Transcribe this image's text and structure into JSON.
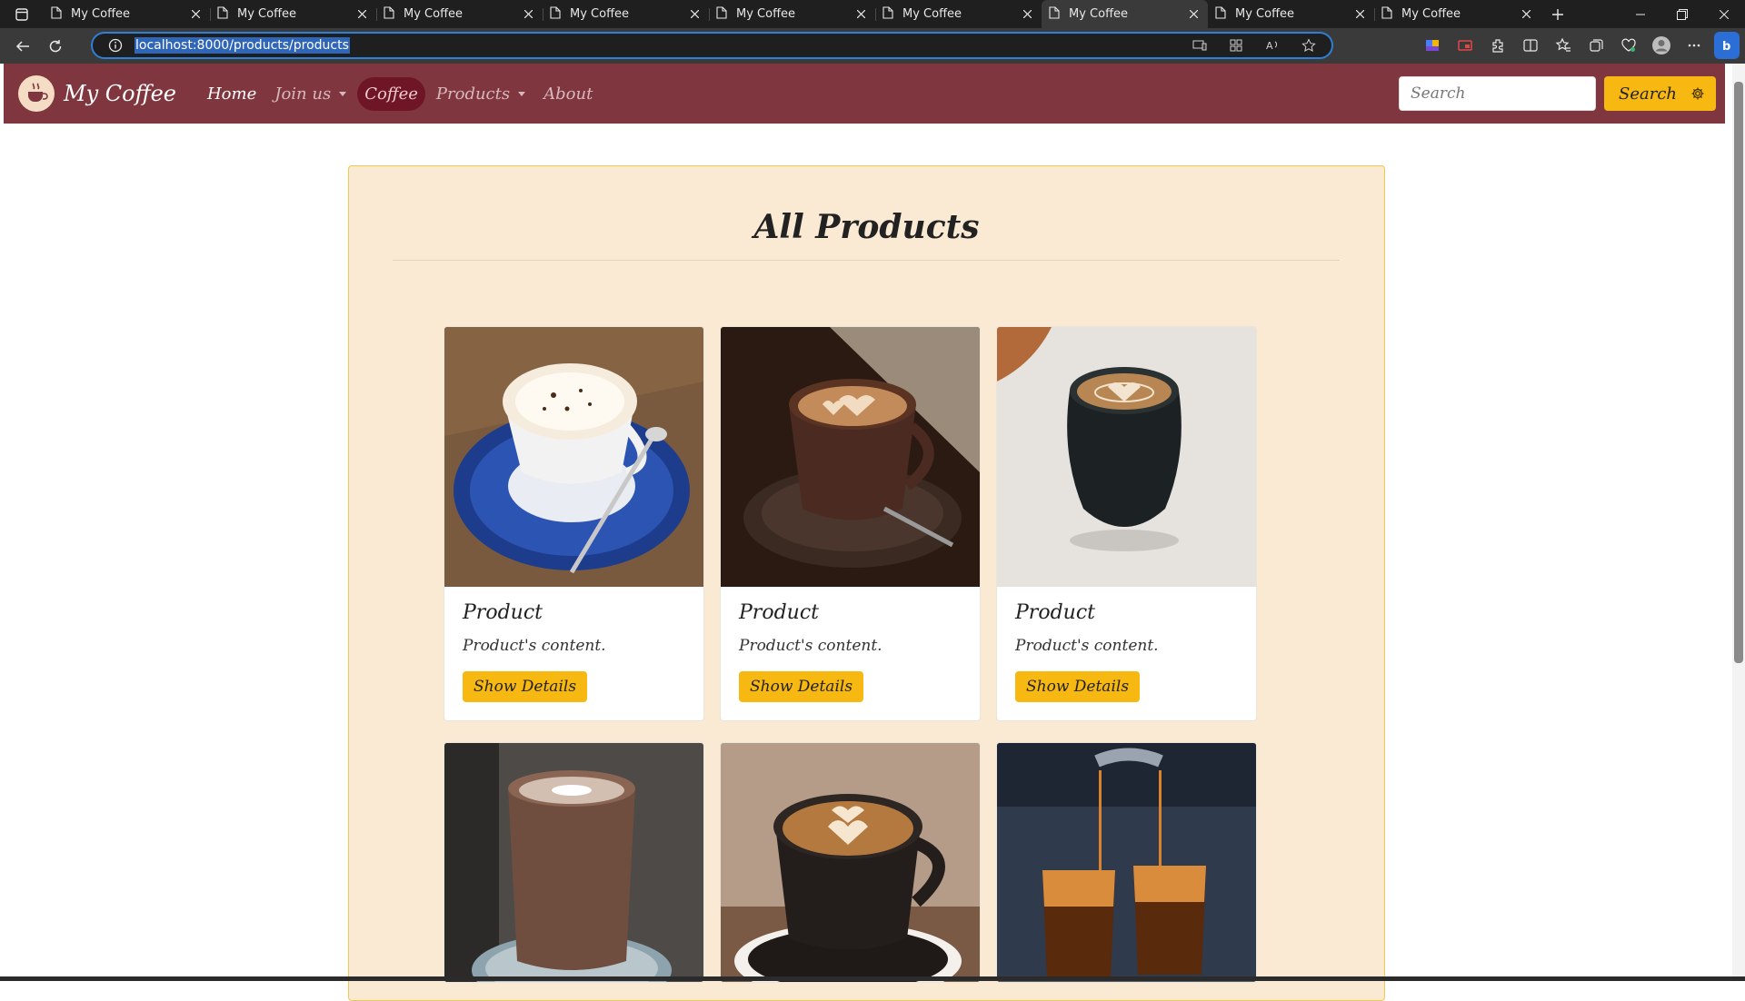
{
  "browser": {
    "tabs": [
      {
        "title": "My Coffee",
        "active": false
      },
      {
        "title": "My Coffee",
        "active": false
      },
      {
        "title": "My Coffee",
        "active": false
      },
      {
        "title": "My Coffee",
        "active": false
      },
      {
        "title": "My Coffee",
        "active": false
      },
      {
        "title": "My Coffee",
        "active": false
      },
      {
        "title": "My Coffee",
        "active": true
      },
      {
        "title": "My Coffee",
        "active": false
      },
      {
        "title": "My Coffee",
        "active": false
      }
    ],
    "url": "localhost:8000/products/products"
  },
  "navbar": {
    "brand": "My Coffee",
    "links": {
      "home": "Home",
      "join": "Join us",
      "coffee": "Coffee",
      "products": "Products",
      "about": "About"
    },
    "search_placeholder": "Search",
    "search_button": "Search"
  },
  "main": {
    "title": "All Products",
    "cards": [
      {
        "title": "Product",
        "text": "Product's content.",
        "button": "Show Details"
      },
      {
        "title": "Product",
        "text": "Product's content.",
        "button": "Show Details"
      },
      {
        "title": "Product",
        "text": "Product's content.",
        "button": "Show Details"
      }
    ]
  },
  "colors": {
    "navbar": "#80363f",
    "accent": "#f7b811",
    "panel": "#fae9d3"
  }
}
